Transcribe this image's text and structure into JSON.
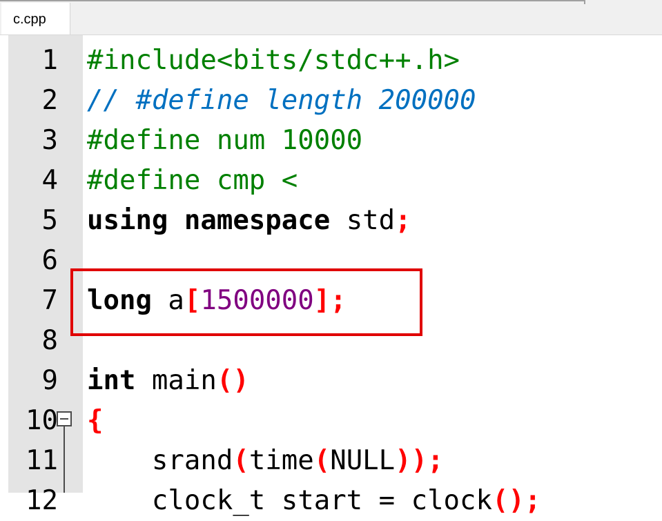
{
  "tabs": [
    {
      "label": "c.cpp",
      "active": true
    }
  ],
  "colors": {
    "preprocessor": "#008000",
    "comment": "#0070c0",
    "keyword": "#000000",
    "number": "#800080",
    "operator": "#ff0000",
    "highlight_box": "#e00000"
  },
  "editor": {
    "line_numbers": [
      "1",
      "2",
      "3",
      "4",
      "5",
      "6",
      "7",
      "8",
      "9",
      "10",
      "11",
      "12"
    ],
    "lines": [
      [
        {
          "t": "pre",
          "v": "#include<bits/stdc++.h>"
        }
      ],
      [
        {
          "t": "cmt",
          "v": "// #define length 200000"
        }
      ],
      [
        {
          "t": "pre",
          "v": "#define num 10000"
        }
      ],
      [
        {
          "t": "pre",
          "v": "#define cmp <"
        }
      ],
      [
        {
          "t": "kw",
          "v": "using"
        },
        {
          "t": "id",
          "v": " "
        },
        {
          "t": "kw",
          "v": "namespace"
        },
        {
          "t": "id",
          "v": " std"
        },
        {
          "t": "op",
          "v": ";"
        }
      ],
      [],
      [
        {
          "t": "kw",
          "v": "long"
        },
        {
          "t": "id",
          "v": " a"
        },
        {
          "t": "op",
          "v": "["
        },
        {
          "t": "num",
          "v": "1500000"
        },
        {
          "t": "op",
          "v": "];"
        }
      ],
      [],
      [
        {
          "t": "kw",
          "v": "int"
        },
        {
          "t": "id",
          "v": " main"
        },
        {
          "t": "op",
          "v": "()"
        }
      ],
      [
        {
          "t": "op",
          "v": "{"
        }
      ],
      [
        {
          "t": "id",
          "v": "    srand"
        },
        {
          "t": "op",
          "v": "("
        },
        {
          "t": "id",
          "v": "time"
        },
        {
          "t": "op",
          "v": "("
        },
        {
          "t": "id",
          "v": "NULL"
        },
        {
          "t": "op",
          "v": "));"
        }
      ],
      [
        {
          "t": "id",
          "v": "    clock_t start = clock"
        },
        {
          "t": "op",
          "v": "();"
        }
      ]
    ],
    "folded_at_line": "10",
    "highlighted_line": "7"
  }
}
